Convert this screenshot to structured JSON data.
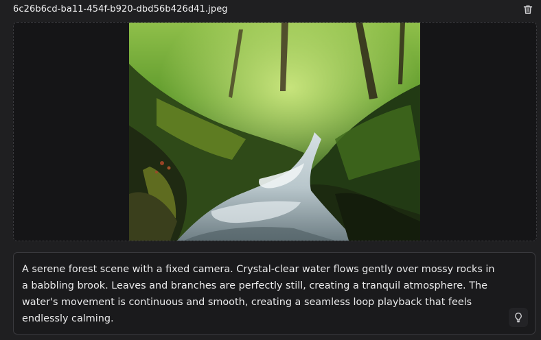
{
  "file": {
    "name": "6c26b6cd-ba11-454f-b920-dbd56b426d41.jpeg",
    "delete_icon": "trash-icon"
  },
  "image": {
    "subject": "forest stream photo"
  },
  "prompt": {
    "text": "A serene forest scene with a fixed camera. Crystal-clear water flows gently over mossy rocks in a babbling brook. Leaves and branches are perfectly still, creating a tranquil atmosphere. The water's movement is continuous and smooth, creating a seamless loop playback that feels endlessly calming.",
    "enhance_icon": "lightbulb-icon"
  },
  "colors": {
    "background": "#1f1f21",
    "border": "#3a3a3e",
    "text": "#eaeaeb"
  }
}
